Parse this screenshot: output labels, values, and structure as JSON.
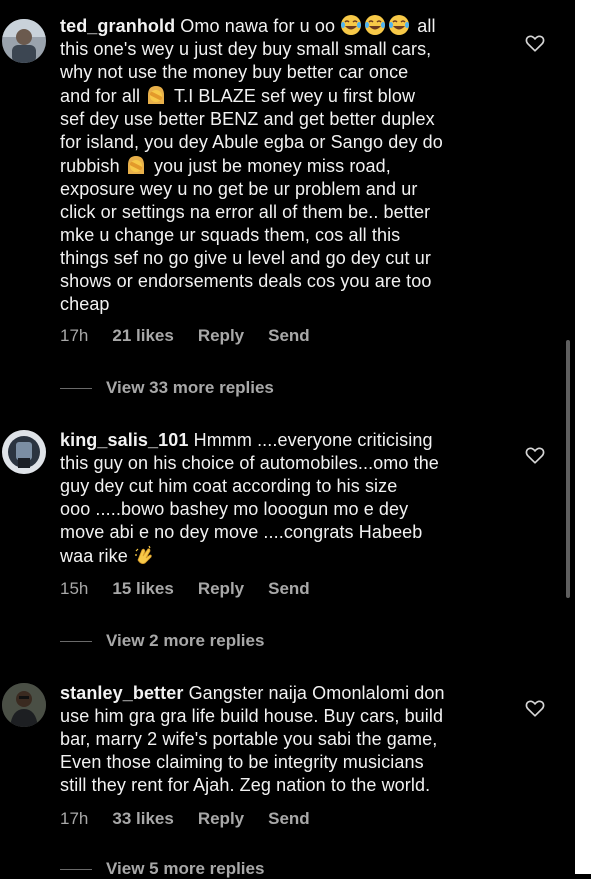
{
  "comments": [
    {
      "username": "ted_granhold",
      "text_before": " Omo nawa for u oo ",
      "text_mid": " all\nthis one's wey u just dey buy small small cars,\nwhy not use the money buy better car once\nand for all ",
      "text_mid2": " T.I BLAZE sef wey u first blow\nsef dey use better BENZ and get better duplex\nfor island, you dey Abule egba or Sango dey do\nrubbish ",
      "text_after": " you just be money miss road,\nexposure wey u no get be ur problem and ur\nclick or settings na error all of them be.. better\nmke u change ur squads them, cos all this\nthings sef no go give u level and go dey cut ur\nshows or endorsements deals cos you are too\ncheap",
      "time": "17h",
      "likes": "21 likes",
      "reply": "Reply",
      "send": "Send",
      "more_replies": "View 33 more replies"
    },
    {
      "username": "king_salis_101",
      "text_before": " Hmmm ....everyone criticising\nthis guy on his choice of automobiles...omo the\nguy dey cut him coat according to his size\nooo .....bowo bashey mo looogun mo e dey\nmove abi e no dey move ....congrats Habeeb\nwaa rike ",
      "time": "15h",
      "likes": "15 likes",
      "reply": "Reply",
      "send": "Send",
      "more_replies": "View 2 more replies"
    },
    {
      "username": "stanley_better",
      "text_before": " Gangster naija Omonlalomi don\nuse him gra gra life build house. Buy cars, build\nbar, marry 2 wife's portable you sabi the game,\nEven those claiming to be integrity musicians\nstill they rent for Ajah. Zeg nation to the world.",
      "time": "17h",
      "likes": "33 likes",
      "reply": "Reply",
      "send": "Send",
      "more_replies": "View 5 more replies"
    }
  ],
  "icons": {
    "laugh": "face-with-tears-of-joy-icon",
    "facepalm": "person-facepalming-icon",
    "clap": "clapping-hands-icon",
    "heart": "heart-outline-icon"
  },
  "colors": {
    "background": "#000000",
    "text": "#f2f2f2",
    "secondary": "#a8a8a8"
  }
}
